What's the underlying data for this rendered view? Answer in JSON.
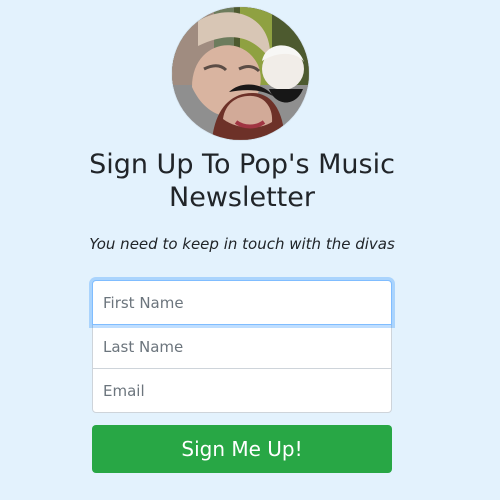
{
  "header": {
    "title": "Sign Up To Pop's Music Newsletter",
    "subtitle": "You need to keep in touch with the divas"
  },
  "logo": {
    "semantic": "collage of three pop singers"
  },
  "form": {
    "first_name_placeholder": "First Name",
    "last_name_placeholder": "Last Name",
    "email_placeholder": "Email",
    "submit_label": "Sign Me Up!"
  },
  "colors": {
    "background": "#e3f2fd",
    "primary_focus": "#80bdff",
    "button": "#28a745"
  }
}
